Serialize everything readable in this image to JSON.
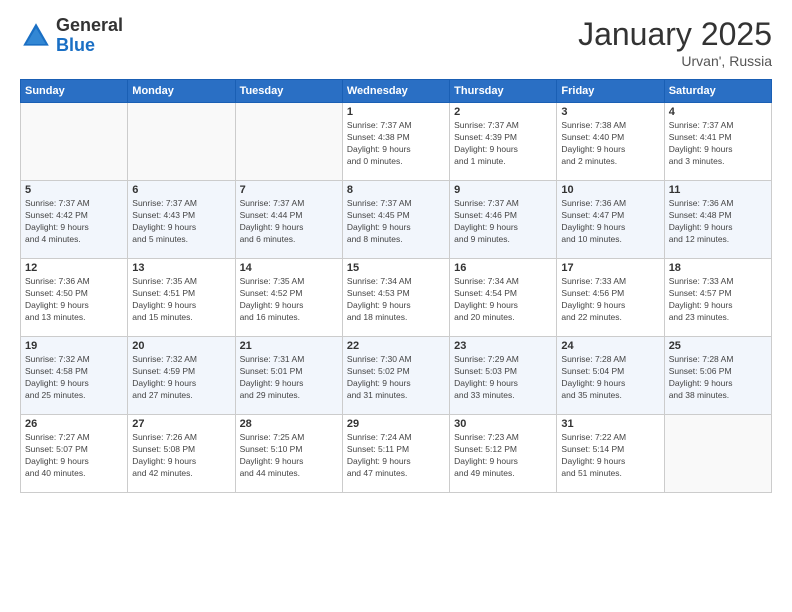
{
  "logo": {
    "general": "General",
    "blue": "Blue"
  },
  "header": {
    "title": "January 2025",
    "location": "Urvan', Russia"
  },
  "days_of_week": [
    "Sunday",
    "Monday",
    "Tuesday",
    "Wednesday",
    "Thursday",
    "Friday",
    "Saturday"
  ],
  "weeks": [
    [
      {
        "day": "",
        "info": ""
      },
      {
        "day": "",
        "info": ""
      },
      {
        "day": "",
        "info": ""
      },
      {
        "day": "1",
        "info": "Sunrise: 7:37 AM\nSunset: 4:38 PM\nDaylight: 9 hours\nand 0 minutes."
      },
      {
        "day": "2",
        "info": "Sunrise: 7:37 AM\nSunset: 4:39 PM\nDaylight: 9 hours\nand 1 minute."
      },
      {
        "day": "3",
        "info": "Sunrise: 7:38 AM\nSunset: 4:40 PM\nDaylight: 9 hours\nand 2 minutes."
      },
      {
        "day": "4",
        "info": "Sunrise: 7:37 AM\nSunset: 4:41 PM\nDaylight: 9 hours\nand 3 minutes."
      }
    ],
    [
      {
        "day": "5",
        "info": "Sunrise: 7:37 AM\nSunset: 4:42 PM\nDaylight: 9 hours\nand 4 minutes."
      },
      {
        "day": "6",
        "info": "Sunrise: 7:37 AM\nSunset: 4:43 PM\nDaylight: 9 hours\nand 5 minutes."
      },
      {
        "day": "7",
        "info": "Sunrise: 7:37 AM\nSunset: 4:44 PM\nDaylight: 9 hours\nand 6 minutes."
      },
      {
        "day": "8",
        "info": "Sunrise: 7:37 AM\nSunset: 4:45 PM\nDaylight: 9 hours\nand 8 minutes."
      },
      {
        "day": "9",
        "info": "Sunrise: 7:37 AM\nSunset: 4:46 PM\nDaylight: 9 hours\nand 9 minutes."
      },
      {
        "day": "10",
        "info": "Sunrise: 7:36 AM\nSunset: 4:47 PM\nDaylight: 9 hours\nand 10 minutes."
      },
      {
        "day": "11",
        "info": "Sunrise: 7:36 AM\nSunset: 4:48 PM\nDaylight: 9 hours\nand 12 minutes."
      }
    ],
    [
      {
        "day": "12",
        "info": "Sunrise: 7:36 AM\nSunset: 4:50 PM\nDaylight: 9 hours\nand 13 minutes."
      },
      {
        "day": "13",
        "info": "Sunrise: 7:35 AM\nSunset: 4:51 PM\nDaylight: 9 hours\nand 15 minutes."
      },
      {
        "day": "14",
        "info": "Sunrise: 7:35 AM\nSunset: 4:52 PM\nDaylight: 9 hours\nand 16 minutes."
      },
      {
        "day": "15",
        "info": "Sunrise: 7:34 AM\nSunset: 4:53 PM\nDaylight: 9 hours\nand 18 minutes."
      },
      {
        "day": "16",
        "info": "Sunrise: 7:34 AM\nSunset: 4:54 PM\nDaylight: 9 hours\nand 20 minutes."
      },
      {
        "day": "17",
        "info": "Sunrise: 7:33 AM\nSunset: 4:56 PM\nDaylight: 9 hours\nand 22 minutes."
      },
      {
        "day": "18",
        "info": "Sunrise: 7:33 AM\nSunset: 4:57 PM\nDaylight: 9 hours\nand 23 minutes."
      }
    ],
    [
      {
        "day": "19",
        "info": "Sunrise: 7:32 AM\nSunset: 4:58 PM\nDaylight: 9 hours\nand 25 minutes."
      },
      {
        "day": "20",
        "info": "Sunrise: 7:32 AM\nSunset: 4:59 PM\nDaylight: 9 hours\nand 27 minutes."
      },
      {
        "day": "21",
        "info": "Sunrise: 7:31 AM\nSunset: 5:01 PM\nDaylight: 9 hours\nand 29 minutes."
      },
      {
        "day": "22",
        "info": "Sunrise: 7:30 AM\nSunset: 5:02 PM\nDaylight: 9 hours\nand 31 minutes."
      },
      {
        "day": "23",
        "info": "Sunrise: 7:29 AM\nSunset: 5:03 PM\nDaylight: 9 hours\nand 33 minutes."
      },
      {
        "day": "24",
        "info": "Sunrise: 7:28 AM\nSunset: 5:04 PM\nDaylight: 9 hours\nand 35 minutes."
      },
      {
        "day": "25",
        "info": "Sunrise: 7:28 AM\nSunset: 5:06 PM\nDaylight: 9 hours\nand 38 minutes."
      }
    ],
    [
      {
        "day": "26",
        "info": "Sunrise: 7:27 AM\nSunset: 5:07 PM\nDaylight: 9 hours\nand 40 minutes."
      },
      {
        "day": "27",
        "info": "Sunrise: 7:26 AM\nSunset: 5:08 PM\nDaylight: 9 hours\nand 42 minutes."
      },
      {
        "day": "28",
        "info": "Sunrise: 7:25 AM\nSunset: 5:10 PM\nDaylight: 9 hours\nand 44 minutes."
      },
      {
        "day": "29",
        "info": "Sunrise: 7:24 AM\nSunset: 5:11 PM\nDaylight: 9 hours\nand 47 minutes."
      },
      {
        "day": "30",
        "info": "Sunrise: 7:23 AM\nSunset: 5:12 PM\nDaylight: 9 hours\nand 49 minutes."
      },
      {
        "day": "31",
        "info": "Sunrise: 7:22 AM\nSunset: 5:14 PM\nDaylight: 9 hours\nand 51 minutes."
      },
      {
        "day": "",
        "info": ""
      }
    ]
  ]
}
